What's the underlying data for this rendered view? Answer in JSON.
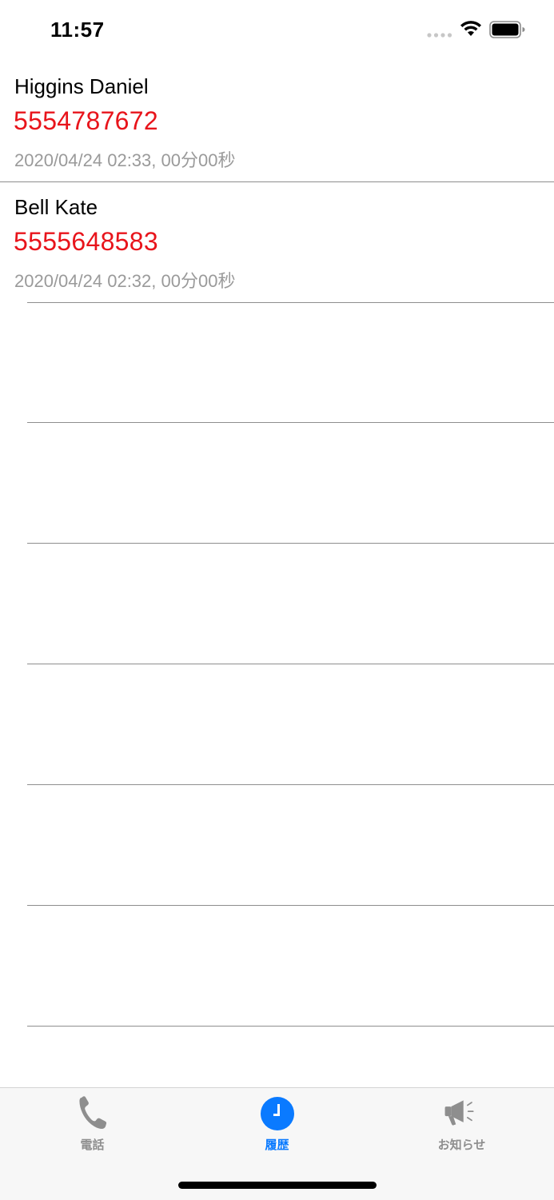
{
  "status_bar": {
    "time": "11:57"
  },
  "calls": [
    {
      "name": "Higgins Daniel",
      "number": "5554787672",
      "meta": "2020/04/24 02:33, 00分00秒"
    },
    {
      "name": "Bell Kate",
      "number": "5555648583",
      "meta": "2020/04/24 02:32, 00分00秒"
    }
  ],
  "colors": {
    "number": "#e8141b",
    "meta": "#9a9a9a",
    "active_tab": "#0a7aff",
    "inactive_tab": "#8e8e8e",
    "tab_bar_bg": "#f7f7f7"
  },
  "tab_bar": {
    "tabs": [
      {
        "label": "電話",
        "icon": "phone-icon",
        "active": false
      },
      {
        "label": "履歴",
        "icon": "clock-icon",
        "active": true
      },
      {
        "label": "お知らせ",
        "icon": "megaphone-icon",
        "active": false
      }
    ]
  }
}
